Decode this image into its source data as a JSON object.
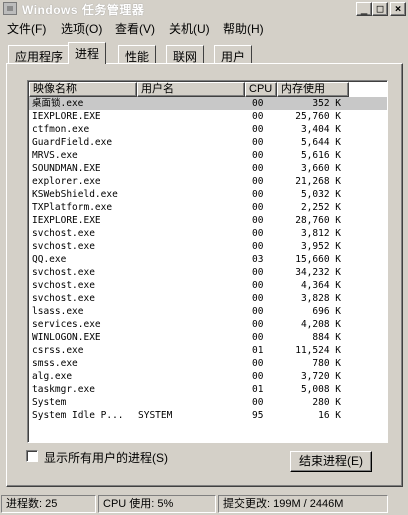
{
  "window": {
    "title": "Windows 任务管理器"
  },
  "menu": [
    "文件(F)",
    "选项(O)",
    "查看(V)",
    "关机(U)",
    "帮助(H)"
  ],
  "tabs": [
    "应用程序",
    "进程",
    "性能",
    "联网",
    "用户"
  ],
  "active_tab": 1,
  "columns": {
    "name": "映像名称",
    "user": "用户名",
    "cpu": "CPU",
    "mem": "内存使用"
  },
  "processes": [
    {
      "name": "桌面锁.exe",
      "user": "",
      "cpu": "00",
      "mem": "352 K"
    },
    {
      "name": "IEXPLORE.EXE",
      "user": "",
      "cpu": "00",
      "mem": "25,760 K"
    },
    {
      "name": "ctfmon.exe",
      "user": "",
      "cpu": "00",
      "mem": "3,404 K"
    },
    {
      "name": "GuardField.exe",
      "user": "",
      "cpu": "00",
      "mem": "5,644 K"
    },
    {
      "name": "MRVS.exe",
      "user": "",
      "cpu": "00",
      "mem": "5,616 K"
    },
    {
      "name": "SOUNDMAN.EXE",
      "user": "",
      "cpu": "00",
      "mem": "3,660 K"
    },
    {
      "name": "explorer.exe",
      "user": "",
      "cpu": "00",
      "mem": "21,268 K"
    },
    {
      "name": "KSWebShield.exe",
      "user": "",
      "cpu": "00",
      "mem": "5,032 K"
    },
    {
      "name": "TXPlatform.exe",
      "user": "",
      "cpu": "00",
      "mem": "2,252 K"
    },
    {
      "name": "IEXPLORE.EXE",
      "user": "",
      "cpu": "00",
      "mem": "28,760 K"
    },
    {
      "name": "svchost.exe",
      "user": "",
      "cpu": "00",
      "mem": "3,812 K"
    },
    {
      "name": "svchost.exe",
      "user": "",
      "cpu": "00",
      "mem": "3,952 K"
    },
    {
      "name": "QQ.exe",
      "user": "",
      "cpu": "03",
      "mem": "15,660 K"
    },
    {
      "name": "svchost.exe",
      "user": "",
      "cpu": "00",
      "mem": "34,232 K"
    },
    {
      "name": "svchost.exe",
      "user": "",
      "cpu": "00",
      "mem": "4,364 K"
    },
    {
      "name": "svchost.exe",
      "user": "",
      "cpu": "00",
      "mem": "3,828 K"
    },
    {
      "name": "lsass.exe",
      "user": "",
      "cpu": "00",
      "mem": "696 K"
    },
    {
      "name": "services.exe",
      "user": "",
      "cpu": "00",
      "mem": "4,208 K"
    },
    {
      "name": "WINLOGON.EXE",
      "user": "",
      "cpu": "00",
      "mem": "884 K"
    },
    {
      "name": "csrss.exe",
      "user": "",
      "cpu": "01",
      "mem": "11,524 K"
    },
    {
      "name": "smss.exe",
      "user": "",
      "cpu": "00",
      "mem": "780 K"
    },
    {
      "name": "alg.exe",
      "user": "",
      "cpu": "00",
      "mem": "3,720 K"
    },
    {
      "name": "taskmgr.exe",
      "user": "",
      "cpu": "01",
      "mem": "5,008 K"
    },
    {
      "name": "System",
      "user": "",
      "cpu": "00",
      "mem": "280 K"
    },
    {
      "name": "System Idle P...",
      "user": "SYSTEM",
      "cpu": "95",
      "mem": "16 K"
    }
  ],
  "selected_row": 0,
  "show_all_users": {
    "label": "显示所有用户的进程(S)",
    "checked": false
  },
  "end_process_label": "结束进程(E)",
  "status": {
    "processes": "进程数: 25",
    "cpu": "CPU 使用: 5%",
    "commit": "提交更改: 199M / 2446M"
  }
}
